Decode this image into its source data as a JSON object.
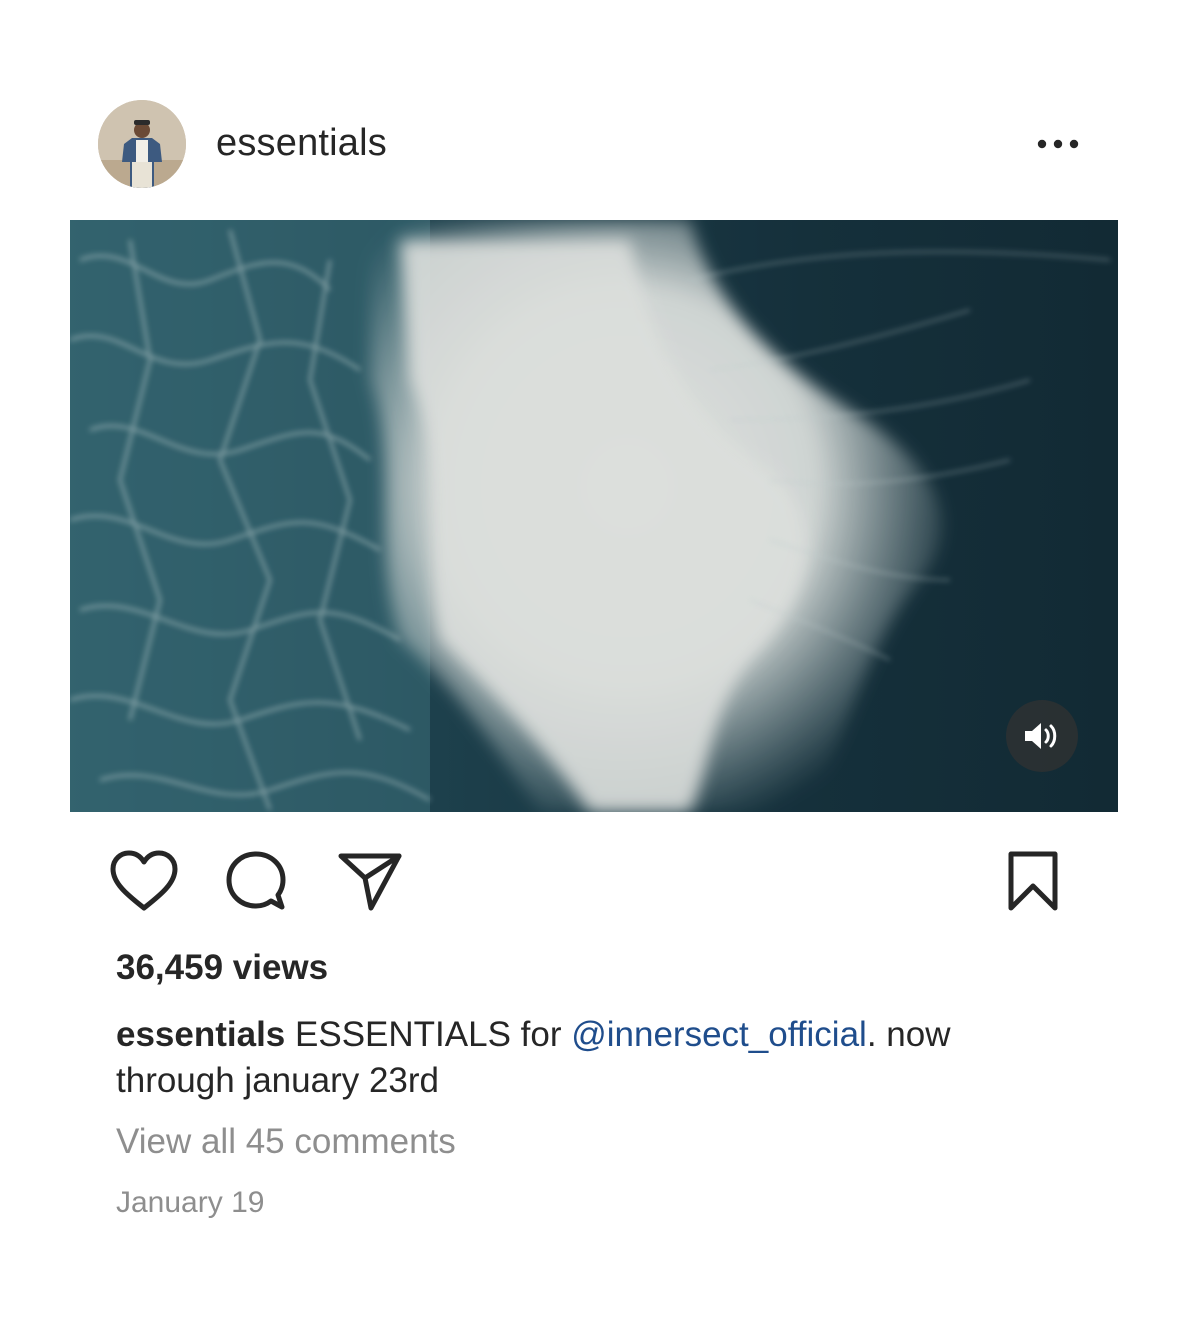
{
  "post": {
    "username": "essentials",
    "views": "36,459 views",
    "caption": {
      "username": "essentials",
      "text_before": " ESSENTIALS for ",
      "mention": "@innersect_official",
      "text_after": ". now through january 23rd"
    },
    "comments_link": "View all 45 comments",
    "date": "January 19"
  },
  "icons": {
    "more": "more-horizontal-icon",
    "volume": "volume-on-icon",
    "like": "heart-icon",
    "comment": "comment-bubble-icon",
    "share": "paper-plane-icon",
    "save": "bookmark-icon"
  },
  "colors": {
    "text": "#262626",
    "secondary_text": "#8e8e8e",
    "mention": "#1f4d8c",
    "background": "#ffffff"
  }
}
